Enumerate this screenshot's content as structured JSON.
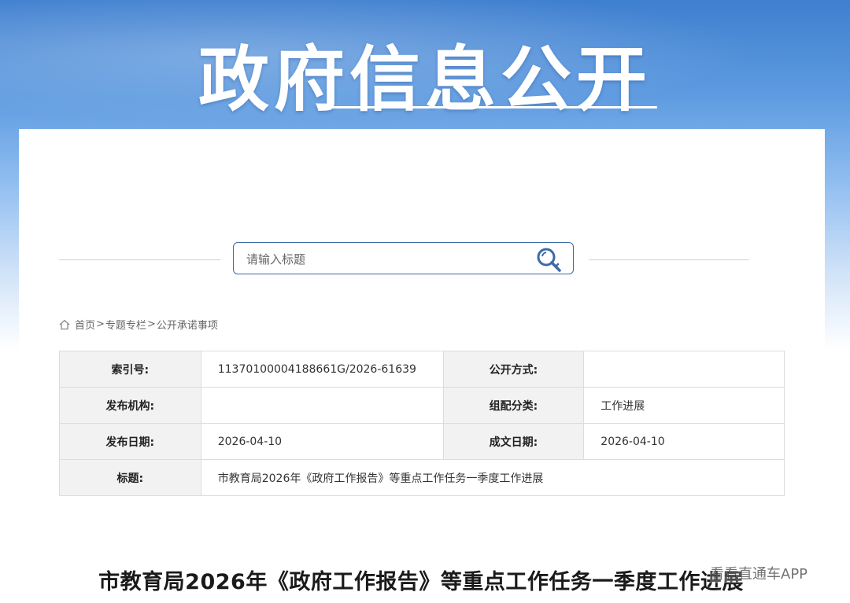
{
  "banner": {
    "title": "政府信息公开"
  },
  "search": {
    "placeholder": "请输入标题",
    "value": ""
  },
  "breadcrumb": {
    "items": [
      "首页",
      "专题专栏",
      "公开承诺事项"
    ],
    "separator": ">"
  },
  "meta_table": {
    "rows": [
      {
        "label1": "索引号:",
        "value1": "11370100004188661G/2026-61639",
        "label2": "公开方式:",
        "value2": ""
      },
      {
        "label1": "发布机构:",
        "value1": "",
        "label2": "组配分类:",
        "value2": "工作进展"
      },
      {
        "label1": "发布日期:",
        "value1": "2026-04-10",
        "label2": "成文日期:",
        "value2": "2026-04-10"
      }
    ],
    "title_row": {
      "label": "标题:",
      "value": "市教育局2026年《政府工作报告》等重点工作任务一季度工作进展"
    }
  },
  "article": {
    "title": "市教育局2026年《政府工作报告》等重点工作任务一季度工作进展"
  },
  "watermark": {
    "text": "看看直通车APP"
  },
  "colors": {
    "accent": "#3c6aa7",
    "banner_blue": "#3f7fcf",
    "label_bg": "#f2f2f2"
  },
  "icons": {
    "search": "search-key-icon",
    "home": "home-icon"
  }
}
